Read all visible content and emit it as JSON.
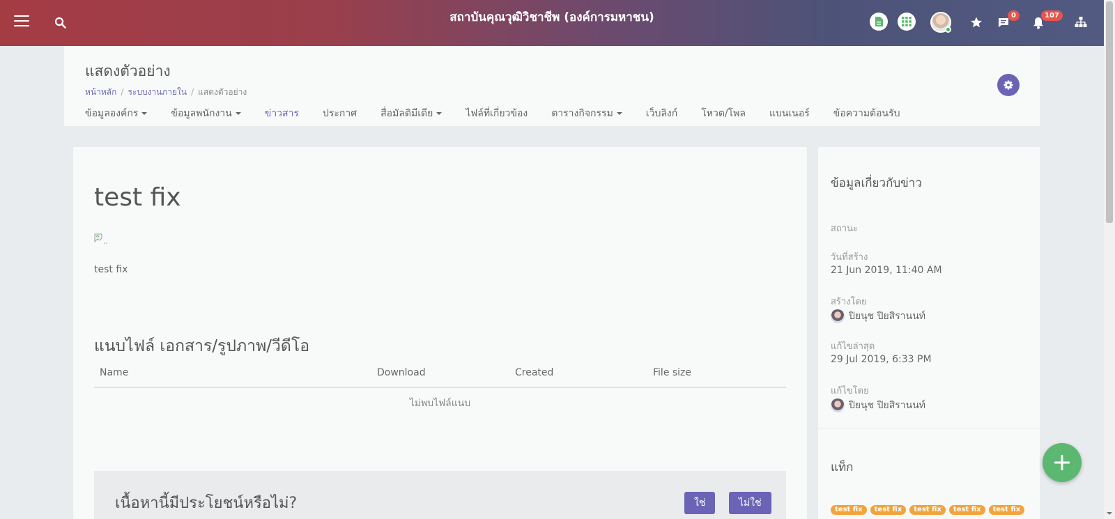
{
  "topbar": {
    "title": "สถาบันคุณวุฒิวิชาชีพ (องค์การมหาชน)",
    "chat_count": "0",
    "notification_count": "107",
    "icons": [
      "menu-icon",
      "search-icon",
      "document-icon",
      "apps-grid-icon",
      "avatar",
      "star-icon",
      "chat-icon",
      "bell-icon",
      "org-chart-icon"
    ]
  },
  "header": {
    "title": "แสดงตัวอย่าง",
    "breadcrumb": [
      "หน้าหลัก",
      "ระบบงานภายใน",
      "แสดงตัวอย่าง"
    ],
    "nav": [
      {
        "label": "ข้อมูลองค์กร",
        "dropdown": true
      },
      {
        "label": "ข้อมูลพนักงาน",
        "dropdown": true
      },
      {
        "label": "ข่าวสาร",
        "dropdown": false,
        "active": true
      },
      {
        "label": "ประกาศ",
        "dropdown": false
      },
      {
        "label": "สื่อมัลติมีเดีย",
        "dropdown": true
      },
      {
        "label": "ไฟล์ที่เกี่ยวข้อง",
        "dropdown": false
      },
      {
        "label": "ตารางกิจกรรม",
        "dropdown": true
      },
      {
        "label": "เว็บลิงก์",
        "dropdown": false
      },
      {
        "label": "โหวต/โพล",
        "dropdown": false
      },
      {
        "label": "แบนเนอร์",
        "dropdown": false
      },
      {
        "label": "ข้อความต้อนรับ",
        "dropdown": false
      }
    ]
  },
  "article": {
    "title": "test fix",
    "body": "test fix",
    "attachments_title": "แนบไฟล์ เอกสาร/รูปภาพ/วีดีโอ",
    "table_headers": [
      "Name",
      "Download",
      "Created",
      "File size"
    ],
    "empty_text": "ไม่พบไฟล์แนบ",
    "helpful_question": "เนื้อหานี้มีประโยชน์หรือไม่?",
    "yes_label": "ใช่",
    "no_label": "ไม่ใช่"
  },
  "side": {
    "heading": "ข้อมูลเกี่ยวกับข่าว",
    "status_label": "สถานะ",
    "created_label": "วันที่สร้าง",
    "created_value": "21 Jun 2019, 11:40 AM",
    "created_by_label": "สร้างโดย",
    "created_by_value": "ปิยนุช ปิยสิรานนท์",
    "updated_label": "แก้ไขล่าสุด",
    "updated_value": "29 Jul 2019, 6:33 PM",
    "updated_by_label": "แก้ไขโดย",
    "updated_by_value": "ปิยนุช ปิยสิรานนท์",
    "tags_heading": "แท็ก",
    "tags": [
      "test fix",
      "test fix",
      "test fix",
      "test fix",
      "test fix"
    ]
  },
  "colors": {
    "accent": "#6b63b6",
    "fab": "#5cb870",
    "tag": "#f2a33a",
    "badge": "#e6554d"
  }
}
